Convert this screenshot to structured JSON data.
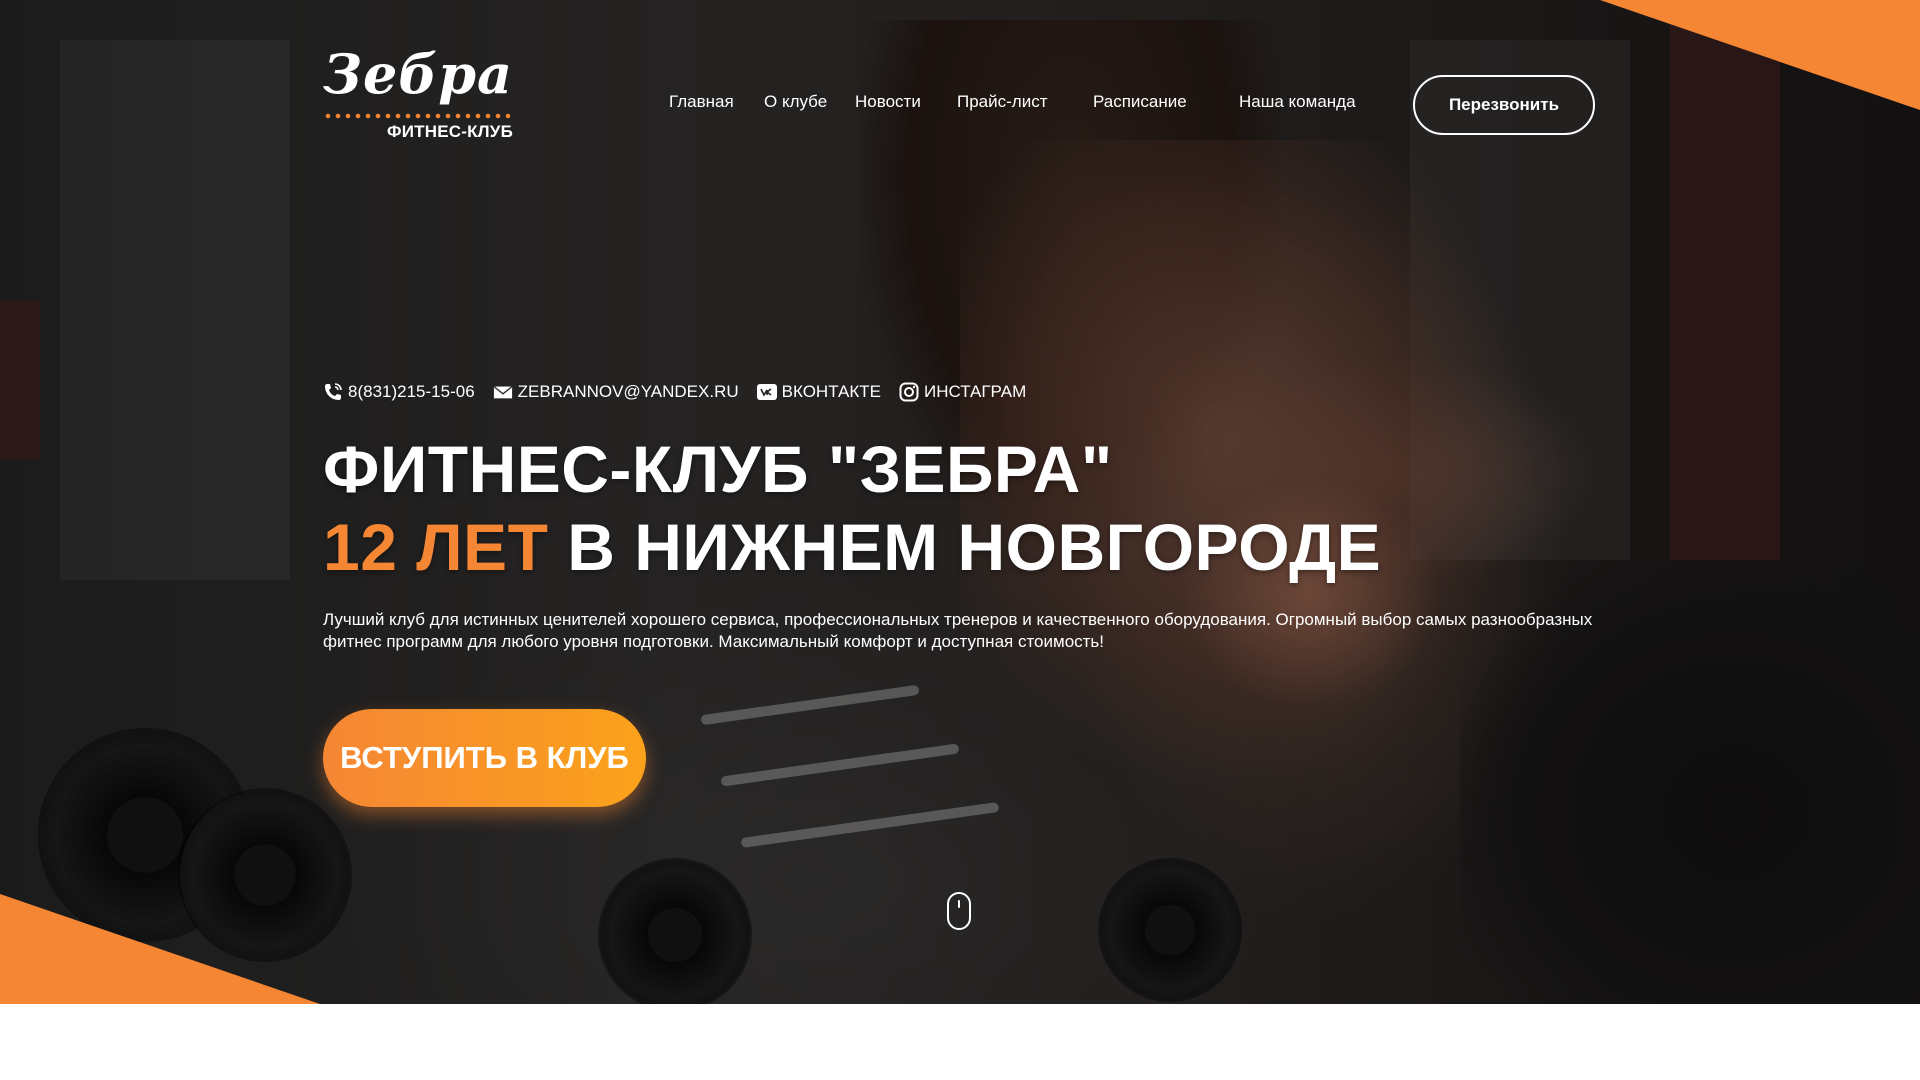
{
  "brand": {
    "logo_word": "Зебра",
    "logo_sub": "ФИТНЕС-КЛУБ",
    "accent_color": "#f58634"
  },
  "nav": {
    "items": [
      {
        "label": "Главная"
      },
      {
        "label": "О клубе"
      },
      {
        "label": "Новости"
      },
      {
        "label": "Прайс-лист"
      },
      {
        "label": "Расписание"
      },
      {
        "label": "Наша команда"
      }
    ],
    "callback_label": "Перезвонить"
  },
  "contacts": {
    "phone": "8(831)215-15-06",
    "email": "ZEBRANNOV@YANDEX.RU",
    "vk": "ВКОНТАКТЕ",
    "instagram": "ИНСТАГРАМ"
  },
  "hero": {
    "title_line1": "ФИТНЕС-КЛУБ \"ЗЕБРА\"",
    "title_accent": "12 ЛЕТ",
    "title_rest": " В НИЖНЕМ НОВГОРОДЕ",
    "description": "Лучший клуб для истинных ценителей хорошего сервиса, профессиональных тренеров и качественного оборудования. Огромный выбор самых разнообразных фитнес программ для любого уровня подготовки. Максимальный комфорт и доступная стоимость!",
    "cta_label": "ВСТУПИТЬ В КЛУБ"
  },
  "icons": {
    "phone": "phone-icon",
    "email": "envelope-icon",
    "vk": "vk-icon",
    "instagram": "instagram-icon",
    "scroll": "mouse-scroll-icon"
  }
}
